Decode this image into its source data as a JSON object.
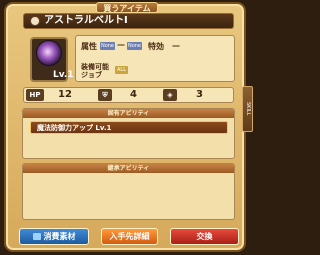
{
  "header": {
    "tab_title": "買うアイテム",
    "item_name": "アストラルベルトⅠ"
  },
  "item": {
    "level_label": "Lv.1"
  },
  "info": {
    "attribute_label": "属性",
    "attr_chip_1": "None",
    "attr_chip_2": "None",
    "special_label": "特効",
    "special_value": "—",
    "equip_label_1": "装備可能",
    "equip_label_2": "ジョブ",
    "job_chip": "ALL"
  },
  "stats": {
    "hp_label": "HP",
    "hp_value": "12",
    "def_value": "4",
    "spd_value": "3"
  },
  "abilities": {
    "fixed_header": "固有アビリティ",
    "fixed_skill": "魔法防御力アップ Lv.1",
    "inherit_header": "継承アビリティ"
  },
  "side_tab": {
    "label": "SKILL"
  },
  "buttons": {
    "materials": "消費素材",
    "acquire": "入手先詳細",
    "exchange": "交換"
  }
}
